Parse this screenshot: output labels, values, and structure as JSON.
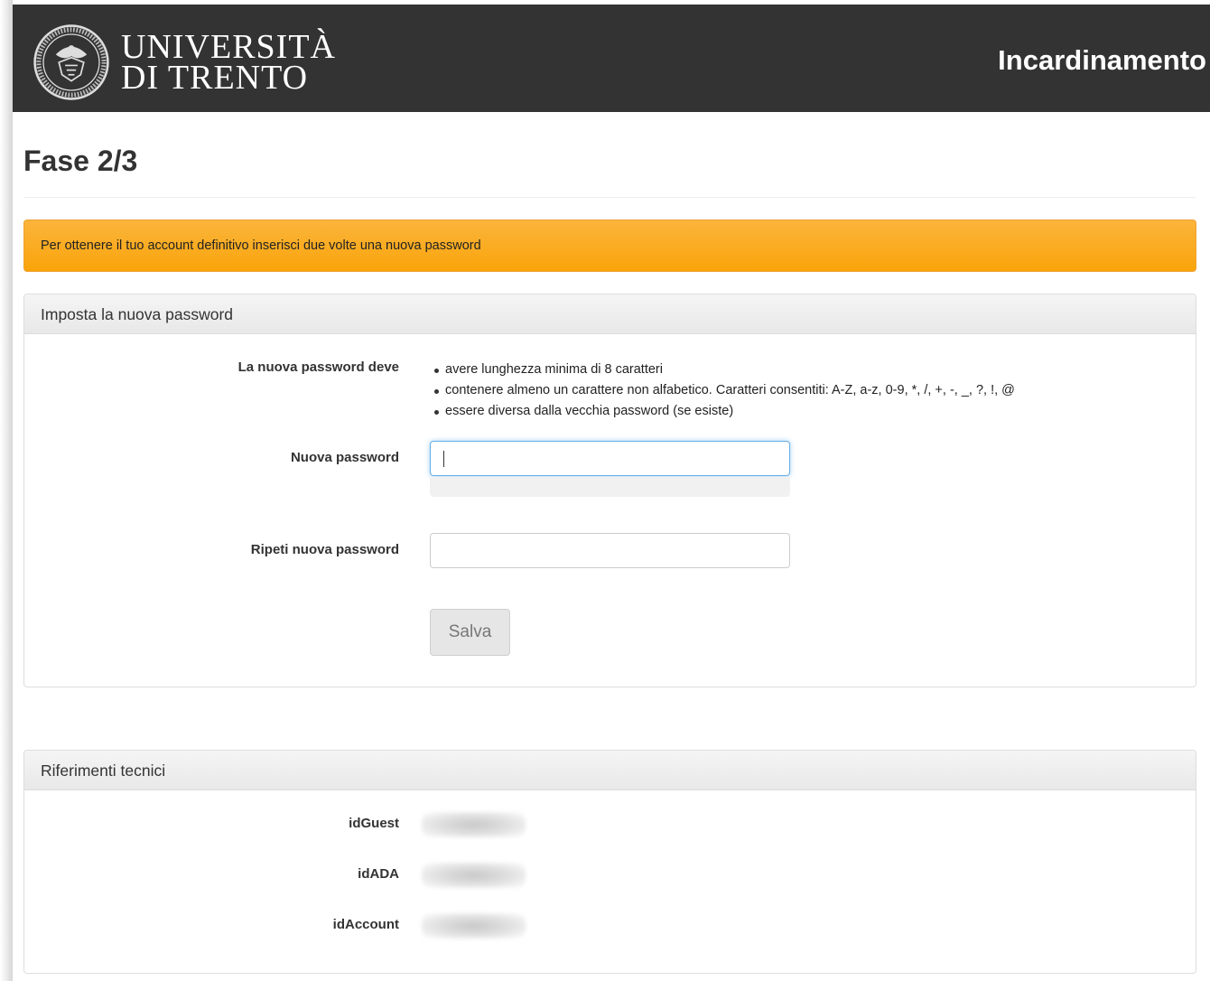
{
  "header": {
    "university_line1": "UNIVERSITÀ",
    "university_line2": "DI TRENTO",
    "app_title": "Incardinamento"
  },
  "page": {
    "title": "Fase 2/3"
  },
  "alert": {
    "text": "Per ottenere il tuo account definitivo inserisci due volte una nuova password",
    "color": "#f9a40a"
  },
  "password_panel": {
    "heading": "Imposta la nuova password",
    "rules_label": "La nuova password deve",
    "rules": [
      "avere lunghezza minima di 8 caratteri",
      "contenere almeno un carattere non alfabetico. Caratteri consentiti: A-Z, a-z, 0-9, *, /, +, -, _, ?, !, @",
      "essere diversa dalla vecchia password (se esiste)"
    ],
    "new_password_label": "Nuova password",
    "new_password_value": "",
    "repeat_password_label": "Ripeti nuova password",
    "repeat_password_value": "",
    "save_label": "Salva"
  },
  "tech_panel": {
    "heading": "Riferimenti tecnici",
    "fields": [
      {
        "label": "idGuest"
      },
      {
        "label": "idADA"
      },
      {
        "label": "idAccount"
      }
    ]
  },
  "colors": {
    "header_bg": "#333333",
    "focus_border": "#66afe9"
  },
  "icons": {
    "logo": "university-seal-icon"
  }
}
